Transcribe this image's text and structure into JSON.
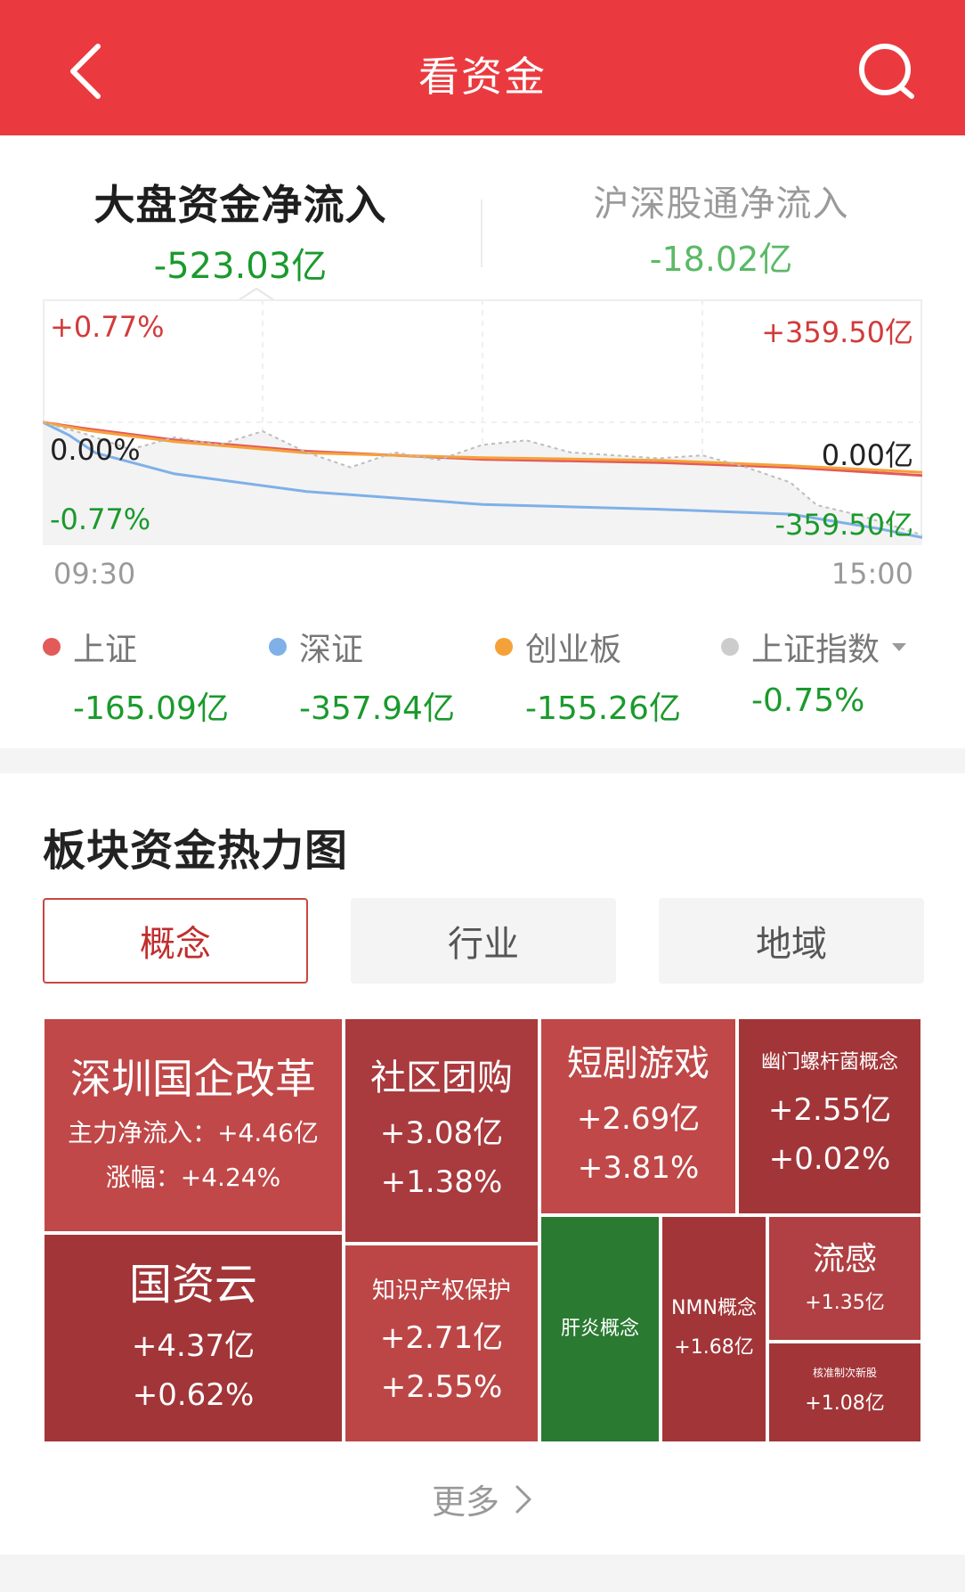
{
  "header": {
    "title": "看资金"
  },
  "tabs": [
    {
      "label": "大盘资金净流入",
      "value": "-523.03亿"
    },
    {
      "label": "沪深股通净流入",
      "value": "-18.02亿"
    }
  ],
  "chart": {
    "y_left": {
      "top": "+0.77%",
      "mid": "0.00%",
      "bottom": "-0.77%"
    },
    "y_right": {
      "top": "+359.50亿",
      "mid": "0.00亿",
      "bottom": "-359.50亿"
    },
    "x": {
      "start": "09:30",
      "end": "15:00"
    }
  },
  "chart_data": {
    "type": "line",
    "x_range": [
      "09:30",
      "15:00"
    ],
    "ylim_percent": [
      -0.77,
      0.77
    ],
    "ylim_amount": [
      -359.5,
      359.5
    ],
    "series": [
      {
        "name": "上证",
        "color": "#e35a5a",
        "x": [
          0,
          0.05,
          0.15,
          0.3,
          0.5,
          0.7,
          0.85,
          1.0
        ],
        "y": [
          0,
          -20,
          -55,
          -90,
          -115,
          -125,
          -140,
          -165.09
        ]
      },
      {
        "name": "深证",
        "color": "#7fb0e8",
        "x": [
          0,
          0.03,
          0.06,
          0.15,
          0.3,
          0.5,
          0.7,
          0.85,
          0.95,
          1.0
        ],
        "y": [
          0,
          -40,
          -95,
          -160,
          -215,
          -255,
          -270,
          -285,
          -330,
          -357.94
        ]
      },
      {
        "name": "创业板",
        "color": "#f5a13a",
        "x": [
          0,
          0.05,
          0.15,
          0.3,
          0.5,
          0.7,
          0.85,
          1.0
        ],
        "y": [
          0,
          -25,
          -60,
          -95,
          -110,
          -118,
          -135,
          -155.26
        ]
      },
      {
        "name": "上证指数",
        "color": "#bdbdbd",
        "x": [
          0,
          0.05,
          0.1,
          0.15,
          0.2,
          0.25,
          0.3,
          0.35,
          0.4,
          0.45,
          0.5,
          0.55,
          0.6,
          0.65,
          0.7,
          0.75,
          0.8,
          0.85,
          0.88,
          0.93,
          1.0
        ],
        "y": [
          0.0,
          -0.08,
          -0.18,
          -0.1,
          -0.15,
          -0.06,
          -0.2,
          -0.3,
          -0.2,
          -0.25,
          -0.15,
          -0.12,
          -0.2,
          -0.22,
          -0.24,
          -0.22,
          -0.3,
          -0.4,
          -0.55,
          -0.62,
          -0.75
        ]
      }
    ]
  },
  "legend": [
    {
      "name": "上证",
      "value": "-165.09亿",
      "color": "#e35a5a"
    },
    {
      "name": "深证",
      "value": "-357.94亿",
      "color": "#7fb0e8"
    },
    {
      "name": "创业板",
      "value": "-155.26亿",
      "color": "#f5a13a"
    },
    {
      "name": "上证指数",
      "value": "-0.75%",
      "color": "#cccccc"
    }
  ],
  "section": {
    "title": "板块资金热力图"
  },
  "segments": [
    "概念",
    "行业",
    "地域"
  ],
  "heatmap": [
    {
      "name": "深圳国企改革",
      "line1": "主力净流入：+4.46亿",
      "line2": "涨幅：+4.24%",
      "color": "#c04848"
    },
    {
      "name": "社区团购",
      "line1": "+3.08亿",
      "line2": "+1.38%",
      "color": "#a93a3e"
    },
    {
      "name": "短剧游戏",
      "line1": "+2.69亿",
      "line2": "+3.81%",
      "color": "#c04848"
    },
    {
      "name": "幽门螺杆菌概念",
      "line1": "+2.55亿",
      "line2": "+0.02%",
      "color": "#a23538"
    },
    {
      "name": "国资云",
      "line1": "+4.37亿",
      "line2": "+0.62%",
      "color": "#a23538"
    },
    {
      "name": "知识产权保护",
      "line1": "+2.71亿",
      "line2": "+2.55%",
      "color": "#bc4646"
    },
    {
      "name": "肝炎概念",
      "line1": "",
      "line2": "",
      "color": "#2a7a32"
    },
    {
      "name": "NMN概念",
      "line1": "+1.68亿",
      "line2": "",
      "color": "#a23538"
    },
    {
      "name": "流感",
      "line1": "+1.35亿",
      "line2": "",
      "color": "#b04043"
    },
    {
      "name": "核准制次新股",
      "line1": "+1.08亿",
      "line2": "",
      "color": "#a23538"
    }
  ],
  "more": {
    "label": "更多"
  }
}
